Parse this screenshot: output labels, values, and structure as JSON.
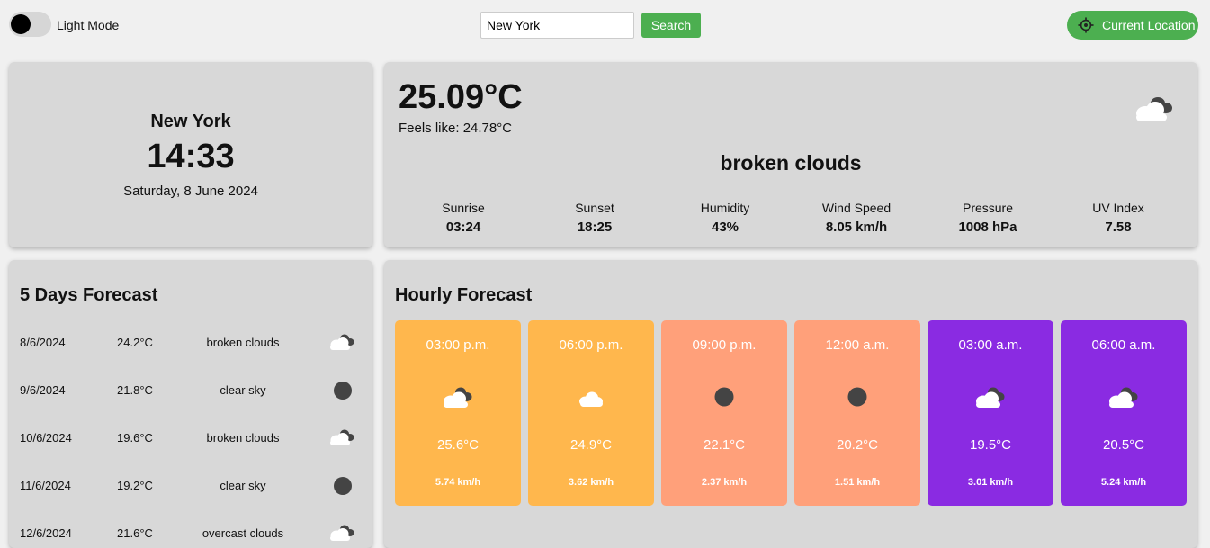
{
  "theme": {
    "mode_label": "Light Mode"
  },
  "search": {
    "value": "New York",
    "button_label": "Search"
  },
  "location_button": {
    "label": "Current Location",
    "icon": "crosshair-icon"
  },
  "city": {
    "name": "New York",
    "time": "14:33",
    "date": "Saturday, 8 June 2024"
  },
  "current": {
    "temperature": "25.09°C",
    "feels_like": "Feels like: 24.78°C",
    "description": "broken clouds",
    "icon": "broken-clouds-icon",
    "stats": [
      {
        "label": "Sunrise",
        "value": "03:24"
      },
      {
        "label": "Sunset",
        "value": "18:25"
      },
      {
        "label": "Humidity",
        "value": "43%"
      },
      {
        "label": "Wind Speed",
        "value": "8.05 km/h"
      },
      {
        "label": "Pressure",
        "value": "1008 hPa"
      },
      {
        "label": "UV Index",
        "value": "7.58"
      }
    ]
  },
  "forecast": {
    "title": "5 Days Forecast",
    "days": [
      {
        "date": "8/6/2024",
        "temp": "24.2°C",
        "desc": "broken clouds",
        "icon": "broken-clouds-icon"
      },
      {
        "date": "9/6/2024",
        "temp": "21.8°C",
        "desc": "clear sky",
        "icon": "clear-sky-icon"
      },
      {
        "date": "10/6/2024",
        "temp": "19.6°C",
        "desc": "broken clouds",
        "icon": "broken-clouds-icon"
      },
      {
        "date": "11/6/2024",
        "temp": "19.2°C",
        "desc": "clear sky",
        "icon": "clear-sky-icon"
      },
      {
        "date": "12/6/2024",
        "temp": "21.6°C",
        "desc": "overcast clouds",
        "icon": "broken-clouds-icon"
      }
    ]
  },
  "hourly": {
    "title": "Hourly Forecast",
    "hours": [
      {
        "time": "03:00 p.m.",
        "temp": "25.6°C",
        "wind": "5.74 km/h",
        "icon": "broken-clouds-icon",
        "color": "#ffb74d"
      },
      {
        "time": "06:00 p.m.",
        "temp": "24.9°C",
        "wind": "3.62 km/h",
        "icon": "cloud-icon",
        "color": "#ffb74d"
      },
      {
        "time": "09:00 p.m.",
        "temp": "22.1°C",
        "wind": "2.37 km/h",
        "icon": "clear-sky-icon",
        "color": "#ffa07a"
      },
      {
        "time": "12:00 a.m.",
        "temp": "20.2°C",
        "wind": "1.51 km/h",
        "icon": "clear-sky-icon",
        "color": "#ffa07a"
      },
      {
        "time": "03:00 a.m.",
        "temp": "19.5°C",
        "wind": "3.01 km/h",
        "icon": "broken-clouds-icon",
        "color": "#8a2be2"
      },
      {
        "time": "06:00 a.m.",
        "temp": "20.5°C",
        "wind": "5.24 km/h",
        "icon": "broken-clouds-icon",
        "color": "#8a2be2"
      }
    ]
  },
  "colors": {
    "accent": "#4caf50",
    "card": "#d8d8d8",
    "background": "#f0f0f0"
  }
}
